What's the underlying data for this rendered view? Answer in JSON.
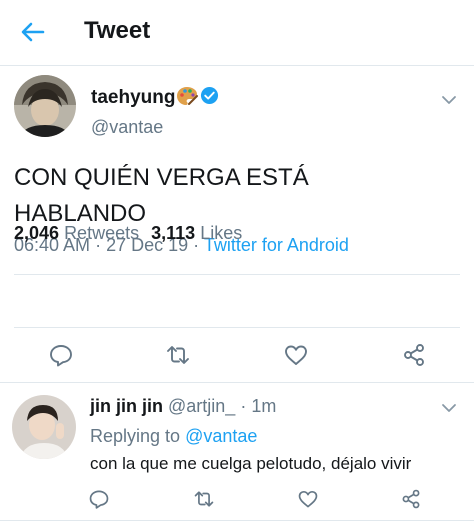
{
  "header": {
    "title": "Tweet",
    "back_icon": "arrow-left-icon"
  },
  "tweet": {
    "author_name": "taehyung",
    "author_badges": [
      "palette-icon",
      "verified-icon"
    ],
    "author_handle": "@vantae",
    "text_line1": "CON QUIÉN VERGA ESTÁ",
    "text_line2": "HABLANDO",
    "time": "06:40 AM",
    "date": "27 Dec 19",
    "source": "Twitter for Android",
    "retweets_count": "2,046",
    "retweets_label": "Retweets",
    "likes_count": "3,113",
    "likes_label": "Likes",
    "actions": [
      "reply-icon",
      "retweet-icon",
      "like-icon",
      "share-icon"
    ]
  },
  "reply": {
    "name": "jin jin jin",
    "handle": "@artjin_",
    "time": "1m",
    "replying_to_label": "Replying to",
    "replying_to_handle": "@vantae",
    "text": "con la que me cuelga pelotudo, déjalo vivir",
    "actions": [
      "reply-icon",
      "retweet-icon",
      "like-icon",
      "share-icon"
    ]
  },
  "colors": {
    "accent": "#1da1f2",
    "text": "#14171a",
    "secondary": "#657786",
    "divider": "#e1e8ed"
  }
}
